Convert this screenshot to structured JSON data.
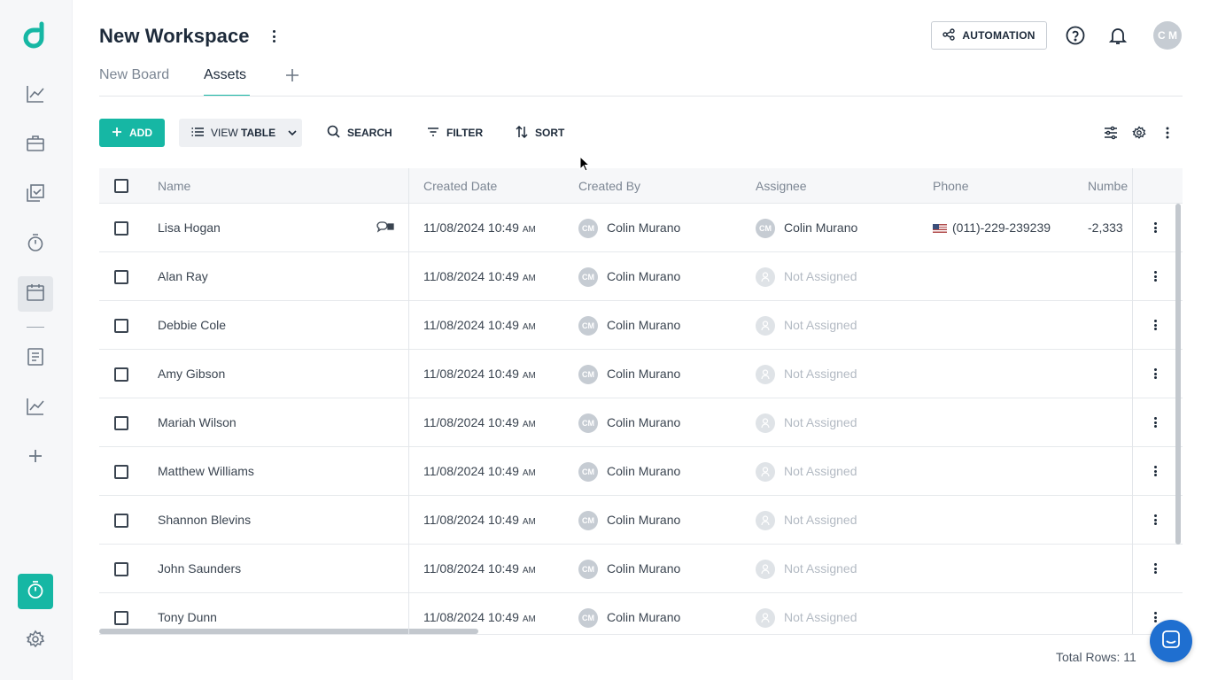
{
  "workspace": {
    "title": "New Workspace"
  },
  "tabs": [
    {
      "label": "New Board",
      "active": false
    },
    {
      "label": "Assets",
      "active": true
    }
  ],
  "header": {
    "automation_label": "AUTOMATION",
    "user_initials": "C M"
  },
  "toolbar": {
    "add_label": "ADD",
    "view_prefix": "VIEW ",
    "view_value": "TABLE",
    "search_label": "SEARCH",
    "filter_label": "FILTER",
    "sort_label": "SORT"
  },
  "table": {
    "columns": [
      "Name",
      "Created Date",
      "Created By",
      "Assignee",
      "Phone",
      "Numbe"
    ],
    "rows": [
      {
        "name": "Lisa Hogan",
        "date": "11/08/2024 10:49",
        "ampm": "AM",
        "created_by_initials": "CM",
        "created_by": "Colin Murano",
        "assignee_initials": "CM",
        "assignee": "Colin Murano",
        "phone": "(011)-229-239239",
        "number": "-2,333"
      },
      {
        "name": "Alan Ray",
        "date": "11/08/2024 10:49",
        "ampm": "AM",
        "created_by_initials": "CM",
        "created_by": "Colin Murano",
        "assignee": "Not Assigned"
      },
      {
        "name": "Debbie Cole",
        "date": "11/08/2024 10:49",
        "ampm": "AM",
        "created_by_initials": "CM",
        "created_by": "Colin Murano",
        "assignee": "Not Assigned"
      },
      {
        "name": "Amy Gibson",
        "date": "11/08/2024 10:49",
        "ampm": "AM",
        "created_by_initials": "CM",
        "created_by": "Colin Murano",
        "assignee": "Not Assigned"
      },
      {
        "name": "Mariah Wilson",
        "date": "11/08/2024 10:49",
        "ampm": "AM",
        "created_by_initials": "CM",
        "created_by": "Colin Murano",
        "assignee": "Not Assigned"
      },
      {
        "name": "Matthew Williams",
        "date": "11/08/2024 10:49",
        "ampm": "AM",
        "created_by_initials": "CM",
        "created_by": "Colin Murano",
        "assignee": "Not Assigned"
      },
      {
        "name": "Shannon Blevins",
        "date": "11/08/2024 10:49",
        "ampm": "AM",
        "created_by_initials": "CM",
        "created_by": "Colin Murano",
        "assignee": "Not Assigned"
      },
      {
        "name": "John Saunders",
        "date": "11/08/2024 10:49",
        "ampm": "AM",
        "created_by_initials": "CM",
        "created_by": "Colin Murano",
        "assignee": "Not Assigned"
      },
      {
        "name": "Tony Dunn",
        "date": "11/08/2024 10:49",
        "ampm": "AM",
        "created_by_initials": "CM",
        "created_by": "Colin Murano",
        "assignee": "Not Assigned"
      }
    ],
    "total_rows_label": "Total Rows: 11"
  },
  "sidebar": {
    "items": [
      {
        "icon": "chart-line-icon"
      },
      {
        "icon": "briefcase-icon"
      },
      {
        "icon": "tasks-icon"
      },
      {
        "icon": "stopwatch-icon"
      },
      {
        "icon": "calendar-icon",
        "active": true
      },
      {
        "icon": "document-icon"
      },
      {
        "icon": "analytics-icon"
      },
      {
        "icon": "plus-icon"
      }
    ],
    "bottom": [
      {
        "icon": "timer-icon"
      },
      {
        "icon": "settings-icon"
      }
    ]
  },
  "colors": {
    "accent": "#16b7a4",
    "chat": "#1f6fd0"
  }
}
